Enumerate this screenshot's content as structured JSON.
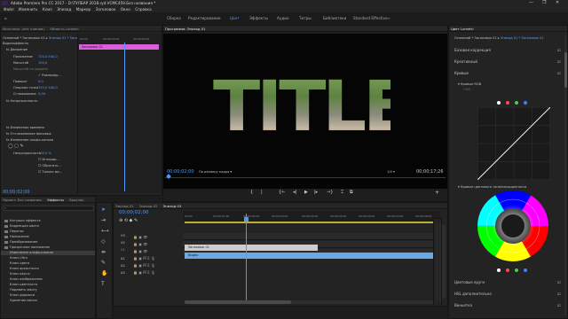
{
  "window": {
    "title": "Adobe Premiere Pro CC 2017 - D:\\ТУЛБАР 2018.ryd.VCMC459.Без названия *",
    "controls": [
      "—",
      "❐",
      "✕"
    ]
  },
  "menu": [
    "Файл",
    "Изменить",
    "Клип",
    "Эпизод",
    "Маркер",
    "Заголовок",
    "Окно",
    "Справка"
  ],
  "workspaces": [
    {
      "label": "Сборка",
      "active": false
    },
    {
      "label": "Редактирование",
      "active": false
    },
    {
      "label": "Цвет",
      "active": true
    },
    {
      "label": "Эффекты",
      "active": false
    },
    {
      "label": "Аудио",
      "active": false
    },
    {
      "label": "Титры",
      "active": false
    },
    {
      "label": "Библиотеки",
      "active": false
    },
    {
      "label": "Standard Effective",
      "active": false
    }
  ],
  "source_panel": {
    "tabs": [
      "Источник: (нет клипов)",
      "Область Lumetri"
    ],
    "clip": "Основной * Заголовок 01",
    "clip2": "Эпизод 01 * Заголовок 01",
    "section": "Видеоэффекты",
    "effects": [
      {
        "label": "fx  Движение",
        "value": ""
      },
      {
        "label": "Положение",
        "value": "720,0     540,0"
      },
      {
        "label": "Масштаб",
        "value": "100,0"
      },
      {
        "label": "Масштаб по ширине",
        "value": "100,0"
      },
      {
        "label": "",
        "value": "✓ Равномер..."
      },
      {
        "label": "Поворот",
        "value": "0,0"
      },
      {
        "label": "Опорная точка",
        "value": "720,0     540,0"
      },
      {
        "label": "Сглаживание",
        "value": "0,00"
      },
      {
        "label": "fx  Непрозрачность",
        "value": ""
      },
      {
        "label": "fx  Изменение времени",
        "value": ""
      },
      {
        "label": "fx  Отслеживание фоновых",
        "value": ""
      },
      {
        "label": "fx  Изменение альфа-канала",
        "value": ""
      },
      {
        "label": "Непрозрачность",
        "value": "100,0 %"
      },
      {
        "label": "",
        "value": "Игнорир..."
      },
      {
        "label": "",
        "value": "Обратить..."
      },
      {
        "label": "",
        "value": "Только ма..."
      }
    ],
    "mini_timeline": {
      "start": "00;00",
      "mark": "00;00;02;00",
      "end": "00;00;04;00",
      "clip": "Заголовок 01"
    },
    "timecode": "00;00;02;00"
  },
  "program_monitor": {
    "tab": "Программа: Эпизод 01",
    "title_text": "TITLE",
    "timecode": "00;00;02;00",
    "fit": "По размеру кадра",
    "quality": "1/4",
    "duration": "00;00;17;26"
  },
  "transport": [
    "{",
    "|",
    "{←",
    "◂|",
    "▶",
    "|▸",
    "→}",
    "⌶",
    "⧉",
    "📷",
    "+"
  ],
  "project_panel": {
    "tabs": [
      "Проект: Без названия",
      "Эффекты",
      "Браузер"
    ],
    "items": [
      "Катушки эффекта",
      "Коррекция цвета",
      "Перенос",
      "Наложение",
      "Преобразование",
      "Прозрачное наложение",
      "Изменение альфа-канала",
      "Ключ Ultra",
      "Ключ цвета",
      "Ключ яркостного",
      "Ключ карты",
      "Ключ изображения",
      "Ключ цветности",
      "Подавить маску",
      "Ключ дорожки",
      "Удаление маски"
    ]
  },
  "timeline": {
    "tabs": [
      "Эпизод 01",
      "Эпизод 02",
      "Эпизод 03"
    ],
    "timecode": "00;00;02;00",
    "ruler": [
      "00;00",
      "00;00;01;00",
      "00;00;02;00",
      "00;00;03;00",
      "00;00;04;00",
      "00;00;05;00",
      "00;00;06;00",
      "00;00;07;00",
      "00;00;08;00"
    ],
    "tracks": [
      "V3",
      "V2",
      "V1",
      "A1",
      "A2",
      "A3"
    ],
    "clips": [
      {
        "label": "Заголовок 01",
        "color": "#cdcdcd"
      },
      {
        "label": "Видео",
        "color": "#6aa9e8"
      }
    ]
  },
  "lumetri": {
    "tab": "Цвет Lumetri",
    "clip": "Основной * Заголовок 01",
    "clip2": "Эпизод 01 * Заголовок 01",
    "sections": [
      {
        "label": "Базовая коррекция",
        "checked": true
      },
      {
        "label": "Креативный",
        "checked": true
      },
      {
        "label": "Кривые",
        "checked": true
      }
    ],
    "curves_label": "Кривые RGB",
    "hue_label": "Кривые цветового тона/насыщенности",
    "bottom_sections": [
      {
        "label": "Цветовые круги",
        "checked": true
      },
      {
        "label": "HSL дополнительно",
        "checked": true
      },
      {
        "label": "Виньетка",
        "checked": true
      }
    ],
    "dot_colors": [
      "#ffffff",
      "#ff4a4a",
      "#4ad04a",
      "#4a7bff"
    ]
  }
}
